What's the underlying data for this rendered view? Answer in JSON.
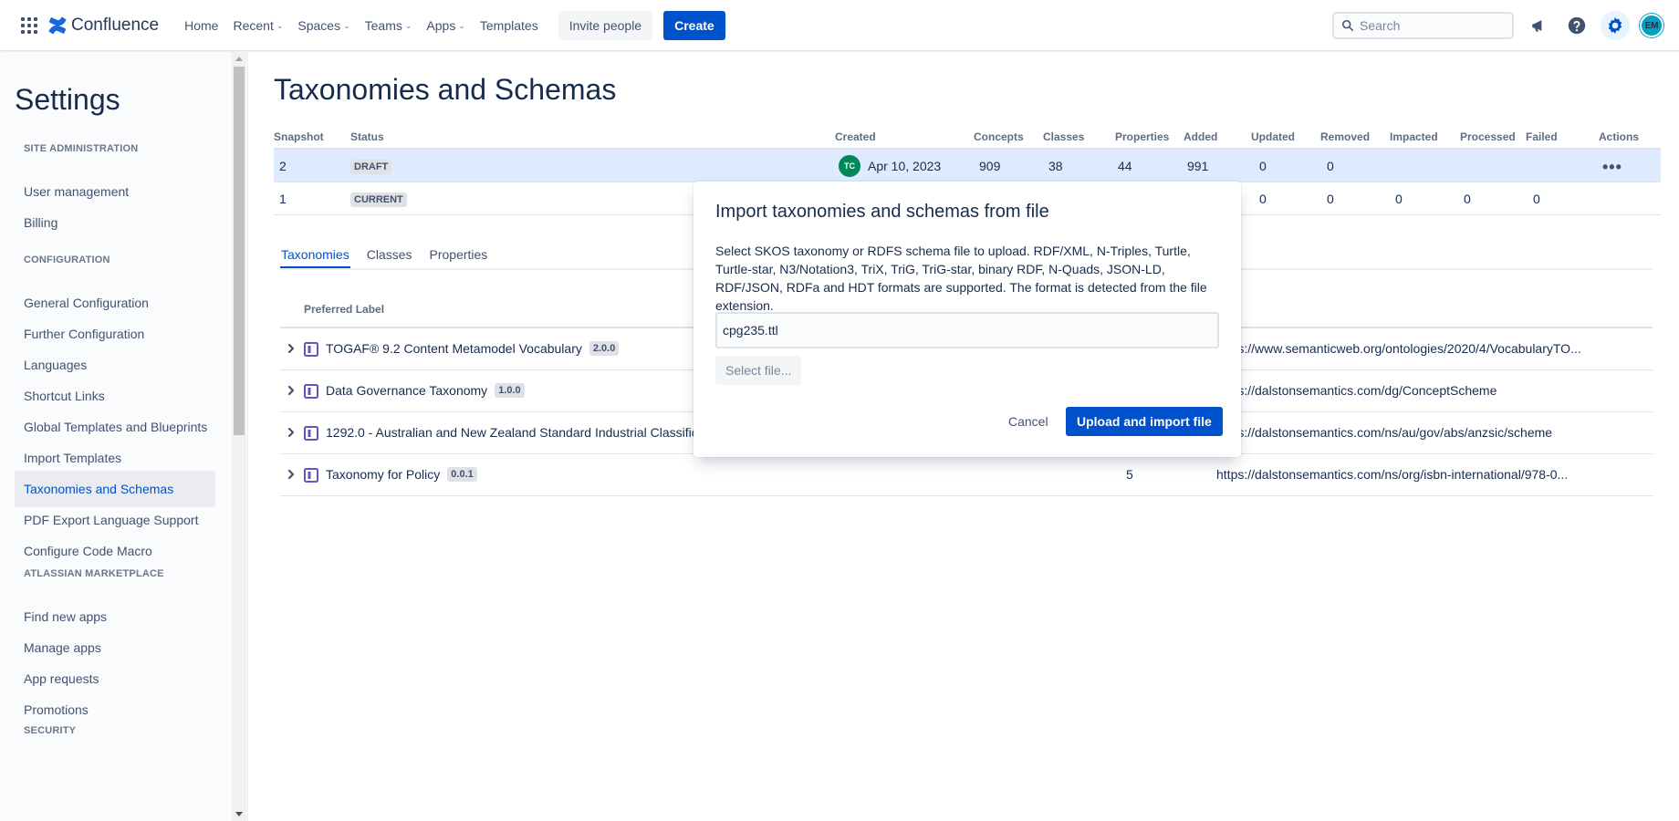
{
  "topnav": {
    "logo_text": "Confluence",
    "items": [
      {
        "label": "Home",
        "dropdown": false
      },
      {
        "label": "Recent",
        "dropdown": true
      },
      {
        "label": "Spaces",
        "dropdown": true
      },
      {
        "label": "Teams",
        "dropdown": true
      },
      {
        "label": "Apps",
        "dropdown": true
      },
      {
        "label": "Templates",
        "dropdown": false
      }
    ],
    "invite_label": "Invite people",
    "create_label": "Create",
    "search_placeholder": "Search",
    "avatar_initials": "EM",
    "brand_color": "#0052cc"
  },
  "sidebar": {
    "title": "Settings",
    "sections": [
      {
        "heading": "SITE ADMINISTRATION",
        "items": [
          "User management",
          "Billing"
        ]
      },
      {
        "heading": "CONFIGURATION",
        "items": [
          "General Configuration",
          "Further Configuration",
          "Languages",
          "Shortcut Links",
          "Global Templates and Blueprints",
          "Import Templates",
          "Taxonomies and Schemas",
          "PDF Export Language Support",
          "Configure Code Macro"
        ]
      },
      {
        "heading": "ATLASSIAN MARKETPLACE",
        "items": [
          "Find new apps",
          "Manage apps",
          "App requests",
          "Promotions"
        ]
      },
      {
        "heading": "SECURITY",
        "items": []
      }
    ],
    "selected_item": "Taxonomies and Schemas"
  },
  "main": {
    "title": "Taxonomies and Schemas",
    "snapshot_table": {
      "headers": [
        "Snapshot",
        "Status",
        "Created",
        "Concepts",
        "Classes",
        "Properties",
        "Added",
        "Updated",
        "Removed",
        "Impacted",
        "Processed",
        "Failed",
        "Actions"
      ],
      "rows": [
        {
          "snapshot": "2",
          "status": "DRAFT",
          "creator_initials": "TC",
          "created": "Apr 10, 2023",
          "concepts": "909",
          "classes": "38",
          "properties": "44",
          "added": "991",
          "updated": "0",
          "removed": "0",
          "impacted": "",
          "processed": "",
          "failed": "",
          "actions": "•••"
        },
        {
          "snapshot": "1",
          "status": "CURRENT",
          "creator_initials": "",
          "created": "",
          "concepts": "",
          "classes": "",
          "properties": "",
          "added": "",
          "updated": "0",
          "removed": "0",
          "impacted": "0",
          "processed": "0",
          "failed": "0",
          "actions": ""
        }
      ]
    },
    "tabs": [
      {
        "label": "Taxonomies",
        "active": true
      },
      {
        "label": "Classes",
        "active": false
      },
      {
        "label": "Properties",
        "active": false
      }
    ],
    "taxonomy_table": {
      "header": "Preferred Label",
      "rows": [
        {
          "label": "TOGAF® 9.2 Content Metamodel Vocabulary",
          "version": "2.0.0",
          "count": "",
          "uri": "https://www.semanticweb.org/ontologies/2020/4/VocabularyTO..."
        },
        {
          "label": "Data Governance Taxonomy",
          "version": "1.0.0",
          "count": "",
          "uri": "https://dalstonsemantics.com/dg/ConceptScheme"
        },
        {
          "label": "1292.0 - Australian and New Zealand Standard Industrial Classifica",
          "version": "",
          "count": "",
          "uri": "https://dalstonsemantics.com/ns/au/gov/abs/anzsic/scheme"
        },
        {
          "label": "Taxonomy for Policy",
          "version": "0.0.1",
          "count": "5",
          "uri": "https://dalstonsemantics.com/ns/org/isbn-international/978-0..."
        }
      ]
    }
  },
  "dialog": {
    "title": "Import taxonomies and schemas from file",
    "description": "Select SKOS taxonomy or RDFS schema file to upload. RDF/XML, N-Triples, Turtle, Turtle-star, N3/Notation3, TriX, TriG, TriG-star, binary RDF, N-Quads, JSON-LD, RDF/JSON, RDFa and HDT formats are supported. The format is detected from the file extension.",
    "file_value": "cpg235.ttl",
    "select_file_label": "Select file...",
    "cancel_label": "Cancel",
    "upload_label": "Upload and import file"
  }
}
